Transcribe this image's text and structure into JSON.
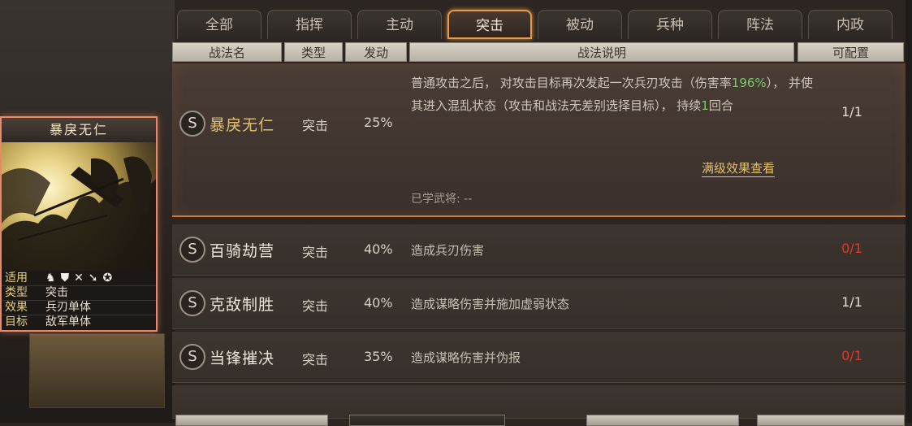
{
  "tabs": [
    {
      "label": "全部"
    },
    {
      "label": "指挥"
    },
    {
      "label": "主动"
    },
    {
      "label": "突击",
      "active": true
    },
    {
      "label": "被动"
    },
    {
      "label": "兵种"
    },
    {
      "label": "阵法"
    },
    {
      "label": "内政"
    }
  ],
  "columns": {
    "name": "战法名",
    "type": "类型",
    "rate": "发动",
    "desc": "战法说明",
    "config": "可配置"
  },
  "skills": [
    {
      "icon": "S",
      "name": "暴戾无仁",
      "type": "突击",
      "rate": "25%",
      "desc_part1": "普通攻击之后， 对攻击目标再次发起一次兵刃攻击（伤害率",
      "desc_highlight": "196%",
      "desc_part2": "）， 并使其进入混乱状态（攻击和战法无差别选择目标）， 持续",
      "desc_highlight2": "1",
      "desc_part3": "回合",
      "config": "1/1",
      "full_effect_link": "满级效果查看",
      "learned_label": "已学武将:",
      "learned_value": "--"
    },
    {
      "icon": "S",
      "name": "百骑劫营",
      "type": "突击",
      "rate": "40%",
      "desc": "造成兵刃伤害",
      "config": "0/1"
    },
    {
      "icon": "S",
      "name": "克敌制胜",
      "type": "突击",
      "rate": "40%",
      "desc": "造成谋略伤害并施加虚弱状态",
      "config": "1/1"
    },
    {
      "icon": "S",
      "name": "当锋摧决",
      "type": "突击",
      "rate": "35%",
      "desc": "造成谋略伤害并伪报",
      "config": "0/1"
    }
  ],
  "card": {
    "title": "暴戾无仁",
    "applicable_label": "适用",
    "type_label": "类型",
    "type_value": "突击",
    "effect_label": "效果",
    "effect_value": "兵刃单体",
    "target_label": "目标",
    "target_value": "敌军单体",
    "unit_icons": [
      "cavalry-icon",
      "shield-icon",
      "bow-icon",
      "spear-icon",
      "wheel-icon"
    ]
  },
  "colors": {
    "accent": "#e79a4a",
    "gold": "#e0c070",
    "red": "#e0392c",
    "green": "#7bc96a"
  }
}
